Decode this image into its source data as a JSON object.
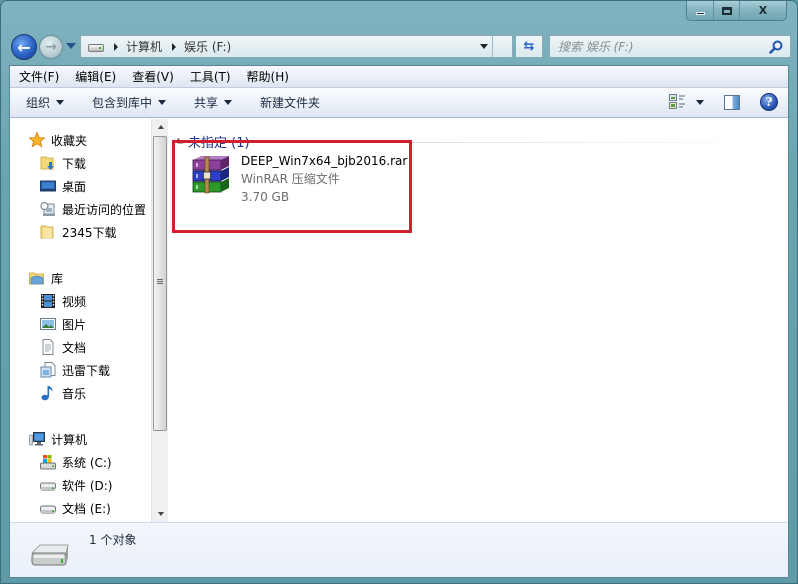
{
  "window": {
    "caption_buttons": {
      "minimize": "minimize",
      "maximize": "maximize",
      "close": "X"
    }
  },
  "navigation": {
    "back_icon": "back-arrow-icon",
    "forward_icon": "forward-arrow-icon",
    "address": {
      "crumbs": [
        "计算机",
        "娱乐 (F:)"
      ]
    },
    "search": {
      "placeholder": "搜索 娱乐 (F:)"
    }
  },
  "menubar": {
    "items": [
      "文件(F)",
      "编辑(E)",
      "查看(V)",
      "工具(T)",
      "帮助(H)"
    ]
  },
  "toolbar": {
    "organize": "组织",
    "include_in_library": "包含到库中",
    "share": "共享",
    "new_folder": "新建文件夹",
    "help": "?"
  },
  "sidebar": {
    "favorites": {
      "label": "收藏夹",
      "items": [
        "下载",
        "桌面",
        "最近访问的位置",
        "2345下载"
      ]
    },
    "libraries": {
      "label": "库",
      "items": [
        "视频",
        "图片",
        "文档",
        "迅雷下载",
        "音乐"
      ]
    },
    "computer": {
      "label": "计算机",
      "items": [
        "系统 (C:)",
        "软件 (D:)",
        "文档 (E:)"
      ]
    }
  },
  "content": {
    "group": {
      "label": "未指定 (1)"
    },
    "files": [
      {
        "name": "DEEP_Win7x64_bjb2016.rar",
        "type": "WinRAR 压缩文件",
        "size": "3.70 GB"
      }
    ],
    "highlight_color": "#d0202d"
  },
  "status": {
    "text": "1 个对象"
  }
}
